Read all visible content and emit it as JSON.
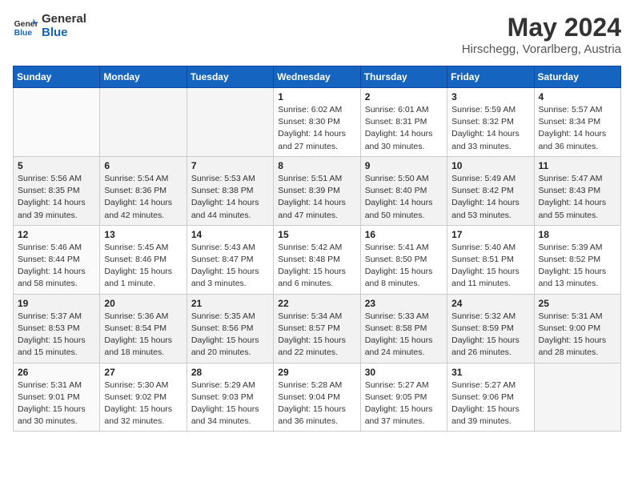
{
  "header": {
    "logo_line1": "General",
    "logo_line2": "Blue",
    "month_year": "May 2024",
    "location": "Hirschegg, Vorarlberg, Austria"
  },
  "weekdays": [
    "Sunday",
    "Monday",
    "Tuesday",
    "Wednesday",
    "Thursday",
    "Friday",
    "Saturday"
  ],
  "weeks": [
    [
      {
        "day": "",
        "info": ""
      },
      {
        "day": "",
        "info": ""
      },
      {
        "day": "",
        "info": ""
      },
      {
        "day": "1",
        "info": "Sunrise: 6:02 AM\nSunset: 8:30 PM\nDaylight: 14 hours\nand 27 minutes."
      },
      {
        "day": "2",
        "info": "Sunrise: 6:01 AM\nSunset: 8:31 PM\nDaylight: 14 hours\nand 30 minutes."
      },
      {
        "day": "3",
        "info": "Sunrise: 5:59 AM\nSunset: 8:32 PM\nDaylight: 14 hours\nand 33 minutes."
      },
      {
        "day": "4",
        "info": "Sunrise: 5:57 AM\nSunset: 8:34 PM\nDaylight: 14 hours\nand 36 minutes."
      }
    ],
    [
      {
        "day": "5",
        "info": "Sunrise: 5:56 AM\nSunset: 8:35 PM\nDaylight: 14 hours\nand 39 minutes."
      },
      {
        "day": "6",
        "info": "Sunrise: 5:54 AM\nSunset: 8:36 PM\nDaylight: 14 hours\nand 42 minutes."
      },
      {
        "day": "7",
        "info": "Sunrise: 5:53 AM\nSunset: 8:38 PM\nDaylight: 14 hours\nand 44 minutes."
      },
      {
        "day": "8",
        "info": "Sunrise: 5:51 AM\nSunset: 8:39 PM\nDaylight: 14 hours\nand 47 minutes."
      },
      {
        "day": "9",
        "info": "Sunrise: 5:50 AM\nSunset: 8:40 PM\nDaylight: 14 hours\nand 50 minutes."
      },
      {
        "day": "10",
        "info": "Sunrise: 5:49 AM\nSunset: 8:42 PM\nDaylight: 14 hours\nand 53 minutes."
      },
      {
        "day": "11",
        "info": "Sunrise: 5:47 AM\nSunset: 8:43 PM\nDaylight: 14 hours\nand 55 minutes."
      }
    ],
    [
      {
        "day": "12",
        "info": "Sunrise: 5:46 AM\nSunset: 8:44 PM\nDaylight: 14 hours\nand 58 minutes."
      },
      {
        "day": "13",
        "info": "Sunrise: 5:45 AM\nSunset: 8:46 PM\nDaylight: 15 hours\nand 1 minute."
      },
      {
        "day": "14",
        "info": "Sunrise: 5:43 AM\nSunset: 8:47 PM\nDaylight: 15 hours\nand 3 minutes."
      },
      {
        "day": "15",
        "info": "Sunrise: 5:42 AM\nSunset: 8:48 PM\nDaylight: 15 hours\nand 6 minutes."
      },
      {
        "day": "16",
        "info": "Sunrise: 5:41 AM\nSunset: 8:50 PM\nDaylight: 15 hours\nand 8 minutes."
      },
      {
        "day": "17",
        "info": "Sunrise: 5:40 AM\nSunset: 8:51 PM\nDaylight: 15 hours\nand 11 minutes."
      },
      {
        "day": "18",
        "info": "Sunrise: 5:39 AM\nSunset: 8:52 PM\nDaylight: 15 hours\nand 13 minutes."
      }
    ],
    [
      {
        "day": "19",
        "info": "Sunrise: 5:37 AM\nSunset: 8:53 PM\nDaylight: 15 hours\nand 15 minutes."
      },
      {
        "day": "20",
        "info": "Sunrise: 5:36 AM\nSunset: 8:54 PM\nDaylight: 15 hours\nand 18 minutes."
      },
      {
        "day": "21",
        "info": "Sunrise: 5:35 AM\nSunset: 8:56 PM\nDaylight: 15 hours\nand 20 minutes."
      },
      {
        "day": "22",
        "info": "Sunrise: 5:34 AM\nSunset: 8:57 PM\nDaylight: 15 hours\nand 22 minutes."
      },
      {
        "day": "23",
        "info": "Sunrise: 5:33 AM\nSunset: 8:58 PM\nDaylight: 15 hours\nand 24 minutes."
      },
      {
        "day": "24",
        "info": "Sunrise: 5:32 AM\nSunset: 8:59 PM\nDaylight: 15 hours\nand 26 minutes."
      },
      {
        "day": "25",
        "info": "Sunrise: 5:31 AM\nSunset: 9:00 PM\nDaylight: 15 hours\nand 28 minutes."
      }
    ],
    [
      {
        "day": "26",
        "info": "Sunrise: 5:31 AM\nSunset: 9:01 PM\nDaylight: 15 hours\nand 30 minutes."
      },
      {
        "day": "27",
        "info": "Sunrise: 5:30 AM\nSunset: 9:02 PM\nDaylight: 15 hours\nand 32 minutes."
      },
      {
        "day": "28",
        "info": "Sunrise: 5:29 AM\nSunset: 9:03 PM\nDaylight: 15 hours\nand 34 minutes."
      },
      {
        "day": "29",
        "info": "Sunrise: 5:28 AM\nSunset: 9:04 PM\nDaylight: 15 hours\nand 36 minutes."
      },
      {
        "day": "30",
        "info": "Sunrise: 5:27 AM\nSunset: 9:05 PM\nDaylight: 15 hours\nand 37 minutes."
      },
      {
        "day": "31",
        "info": "Sunrise: 5:27 AM\nSunset: 9:06 PM\nDaylight: 15 hours\nand 39 minutes."
      },
      {
        "day": "",
        "info": ""
      }
    ]
  ]
}
